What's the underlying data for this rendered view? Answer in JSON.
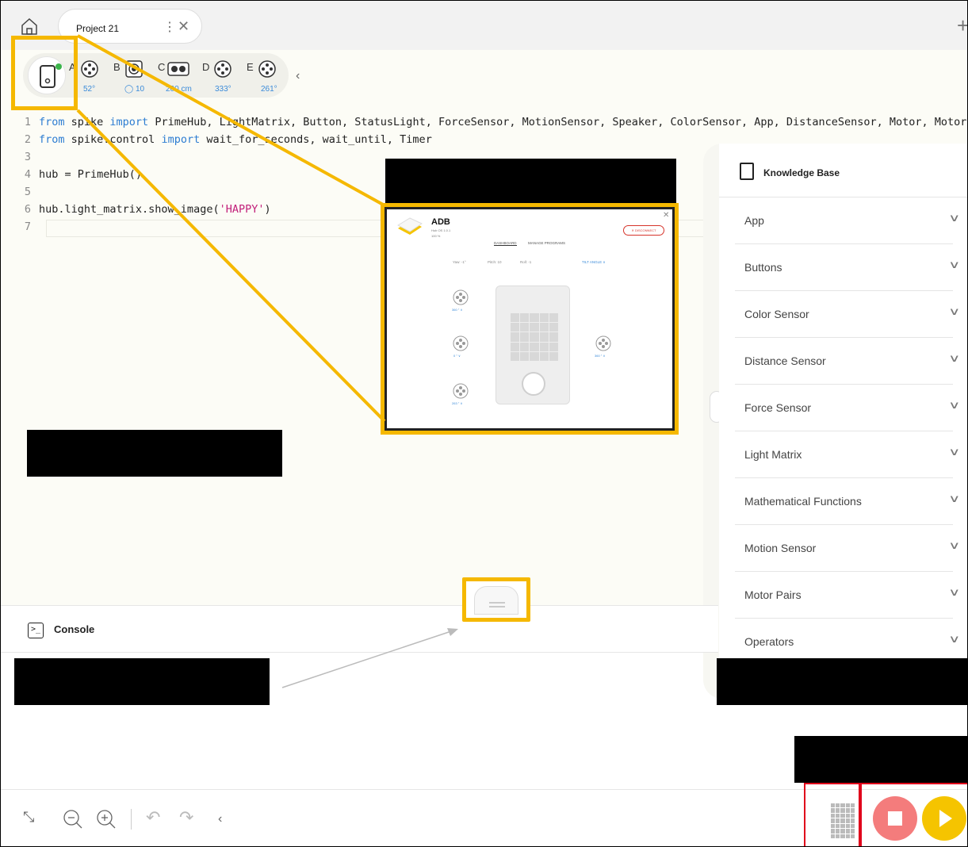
{
  "tab": {
    "title": "Project 21"
  },
  "ports": [
    {
      "letter": "A",
      "value": "52°"
    },
    {
      "letter": "B",
      "value": "10"
    },
    {
      "letter": "C",
      "value": "200 cm"
    },
    {
      "letter": "D",
      "value": "333°"
    },
    {
      "letter": "E",
      "value": "261°"
    }
  ],
  "code": {
    "line1": {
      "n": "1",
      "kw1": "from",
      "t1": " spike ",
      "kw2": "import",
      "t2": " PrimeHub, LightMatrix, Button, StatusLight, ForceSensor, MotionSensor, Speaker, ColorSensor, App, DistanceSensor, Motor, MotorPair"
    },
    "line2": {
      "n": "2",
      "kw1": "from",
      "t1": " spike.control ",
      "kw2": "import",
      "t2": " wait_for_seconds, wait_until, Timer"
    },
    "line3": {
      "n": "3"
    },
    "line4": {
      "n": "4",
      "t": "hub = PrimeHub()"
    },
    "line5": {
      "n": "5"
    },
    "line6": {
      "n": "6",
      "t1": "hub.light_matrix.show_image(",
      "str": "'HAPPY'",
      "t2": ")"
    },
    "line7": {
      "n": "7"
    }
  },
  "zoom": {
    "hub_name": "ADB",
    "hub_sub": "Hub OS 1.0.1",
    "battery": "100 %",
    "disconnect": "✕ DISCONNECT",
    "tab_dashboard": "DASHBOARD",
    "tab_programs": "MANAGE PROGRAMS",
    "yaw": "Yaw: -1°",
    "pitch": "Pitch: 10",
    "roll": "Roll: -1",
    "tilt": "TILT ANGLE ∨",
    "port_a": "360 ° ∨",
    "port_c": "0 ° ∨",
    "port_e": "263 ° ∨",
    "port_d": "360 ° ∨"
  },
  "console": {
    "label": "Console"
  },
  "knowledge_base": {
    "title": "Knowledge Base",
    "items": [
      "App",
      "Buttons",
      "Color Sensor",
      "Distance Sensor",
      "Force Sensor",
      "Light Matrix",
      "Mathematical Functions",
      "Motion Sensor",
      "Motor Pairs",
      "Operators"
    ]
  },
  "colors": {
    "highlight": "#f5b800",
    "red_box": "#e0001b",
    "stop": "#f47c7c",
    "play": "#f5c400",
    "keyword": "#2d7dd2",
    "string": "#c2207a"
  }
}
